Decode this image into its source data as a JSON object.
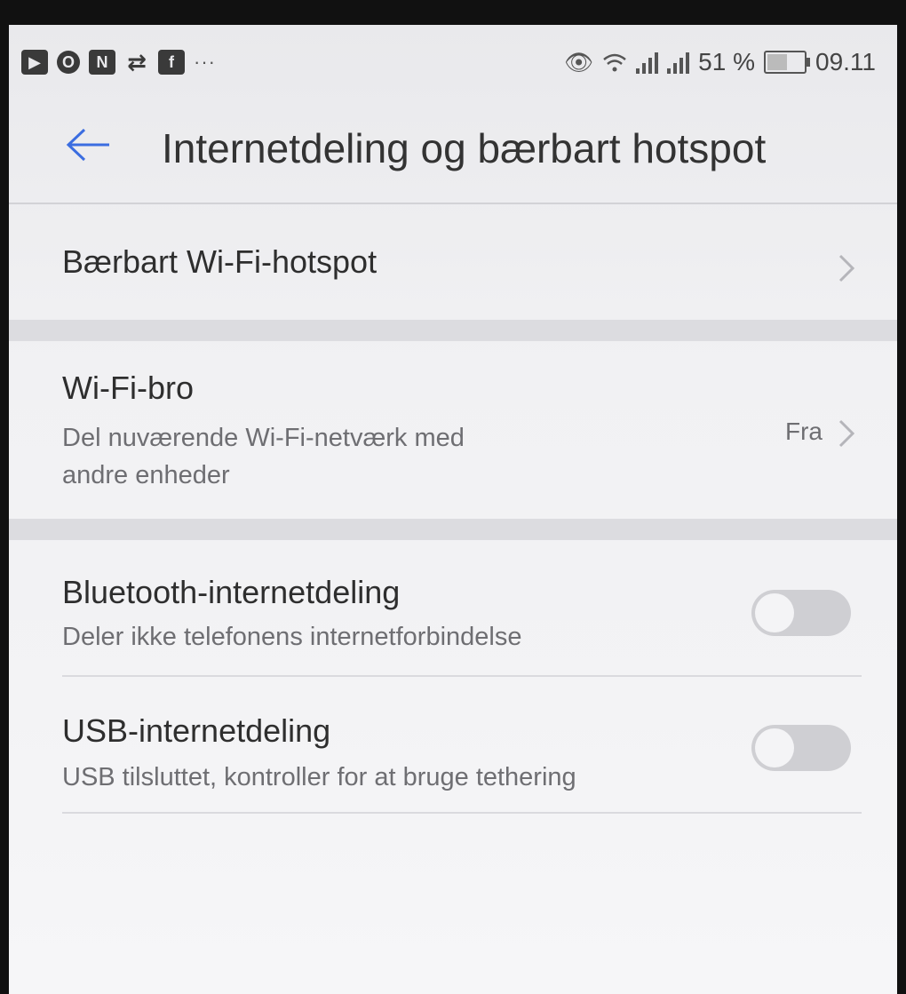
{
  "status_bar": {
    "notification_icons": [
      "youtube-icon",
      "opera-icon",
      "n-app-icon",
      "usb-tether-icon",
      "flipboard-icon"
    ],
    "more": "···",
    "battery_percent": "51 %",
    "time": "09.11"
  },
  "header": {
    "title": "Internetdeling og bærbart hotspot"
  },
  "settings": {
    "hotspot": {
      "title": "Bærbart Wi-Fi-hotspot"
    },
    "wifi_bridge": {
      "title": "Wi-Fi-bro",
      "subtitle_line1": "Del nuværende Wi-Fi-netværk med",
      "subtitle_line2": "andre enheder",
      "state": "Fra"
    },
    "bluetooth": {
      "title": "Bluetooth-internetdeling",
      "subtitle": "Deler ikke telefonens internetforbindelse",
      "enabled": false
    },
    "usb": {
      "title": "USB-internetdeling",
      "subtitle": "USB tilsluttet, kontroller for at bruge tethering",
      "enabled": false
    }
  },
  "colors": {
    "accent": "#3b6de0",
    "text": "#2e2e2e",
    "secondary": "#6e6e72"
  }
}
